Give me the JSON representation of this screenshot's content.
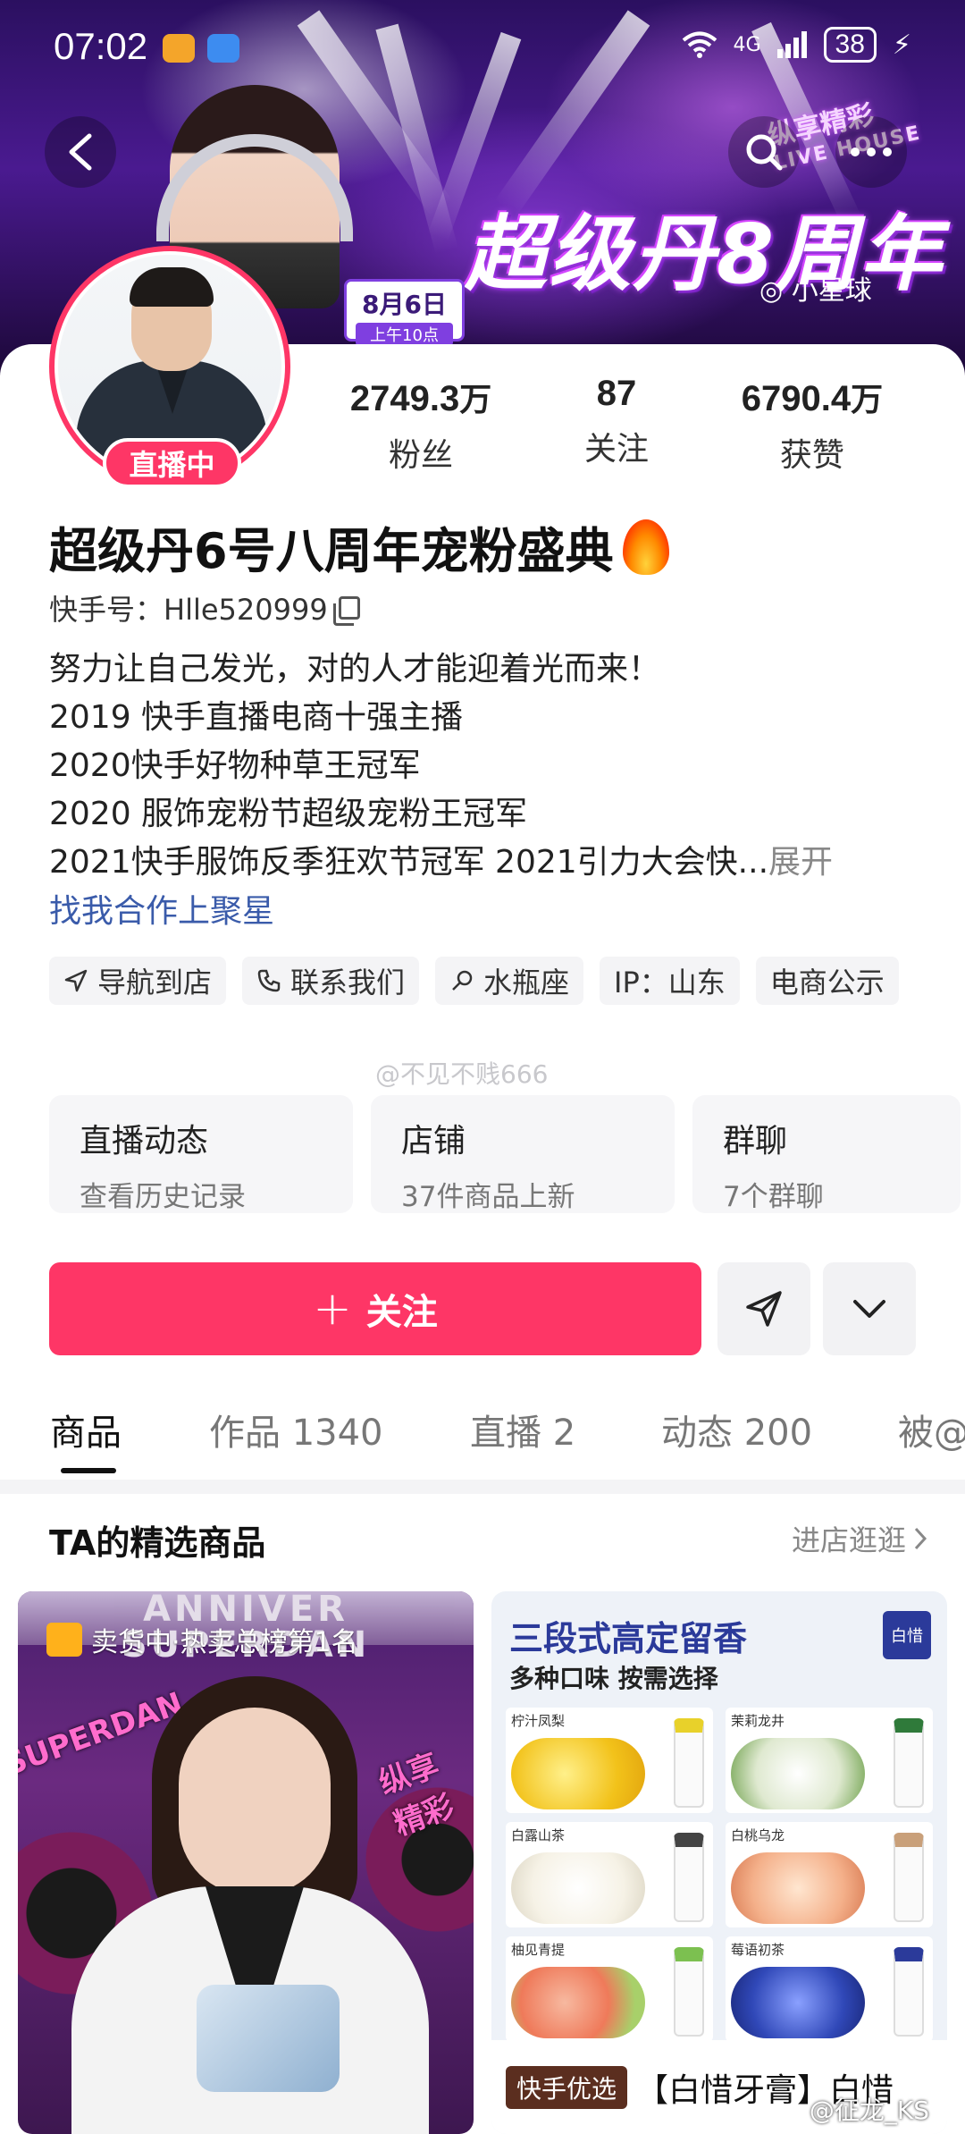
{
  "status_bar": {
    "time": "07:02",
    "network": "4G",
    "battery": "38"
  },
  "banner": {
    "title": "超级丹8周年",
    "live_house_line1": "纵享精彩",
    "live_house_line2": "LIVE HOUSE",
    "date": "8月6日",
    "time_slot": "上午10点",
    "badge": "小星球"
  },
  "profile": {
    "live_label": "直播中",
    "stats": [
      {
        "value": "2749.3",
        "unit": "万",
        "label": "粉丝"
      },
      {
        "value": "87",
        "unit": "",
        "label": "关注"
      },
      {
        "value": "6790.4",
        "unit": "万",
        "label": "获赞"
      }
    ],
    "name": "超级丹6号八周年宠粉盛典",
    "kuaishou_id": "快手号：Hlle520999",
    "bio_lines": [
      "努力让自己发光，对的人才能迎着光而来！",
      "2019 快手直播电商十强主播",
      "2020快手好物种草王冠军",
      "2020 服饰宠粉节超级宠粉王冠军",
      "2021快手服饰反季狂欢节冠军 2021引力大会快..."
    ],
    "expand_label": "展开",
    "cooperation_link": "找我合作上聚星",
    "tags": [
      {
        "label": "导航到店",
        "icon": "navigation-icon"
      },
      {
        "label": "联系我们",
        "icon": "phone-icon"
      },
      {
        "label": "水瓶座",
        "icon": "zodiac-icon"
      },
      {
        "label": "IP：山东",
        "icon": ""
      },
      {
        "label": "电商公示",
        "icon": ""
      }
    ],
    "watermark": "@不见不贱666"
  },
  "feature_cards": [
    {
      "title": "直播动态",
      "subtitle": "查看历史记录"
    },
    {
      "title": "店铺",
      "subtitle": "37件商品上新"
    },
    {
      "title": "群聊",
      "subtitle": "7个群聊"
    }
  ],
  "actions": {
    "follow_plus": "+",
    "follow_label": "关注"
  },
  "tabs": [
    {
      "label": "商品"
    },
    {
      "label": "作品 1340"
    },
    {
      "label": "直播 2"
    },
    {
      "label": "动态 200"
    },
    {
      "label": "被@"
    }
  ],
  "products_section": {
    "title": "TA的精选商品",
    "link": "进店逛逛",
    "product1": {
      "badge": "卖货中·热卖总榜第1名",
      "banner_text": "ANNIVER SUPERDAN",
      "side_left": "SUPERDAN",
      "side_right": "纵享精彩"
    },
    "product2": {
      "headline": "三段式高定留香",
      "subhead": "多种口味 按需选择",
      "logo": "白惜",
      "flavors": [
        "柠汁凤梨",
        "茉莉龙井",
        "白露山茶",
        "白桃乌龙",
        "柚见青提",
        "莓语初茶"
      ],
      "tag": "快手优选",
      "name": "【白惜牙膏】白惜",
      "watermark": "@征龙_KS"
    }
  },
  "colors": {
    "accent": "#fe3666",
    "link": "#3a5baa",
    "brand_blue": "#2b3a9a"
  }
}
